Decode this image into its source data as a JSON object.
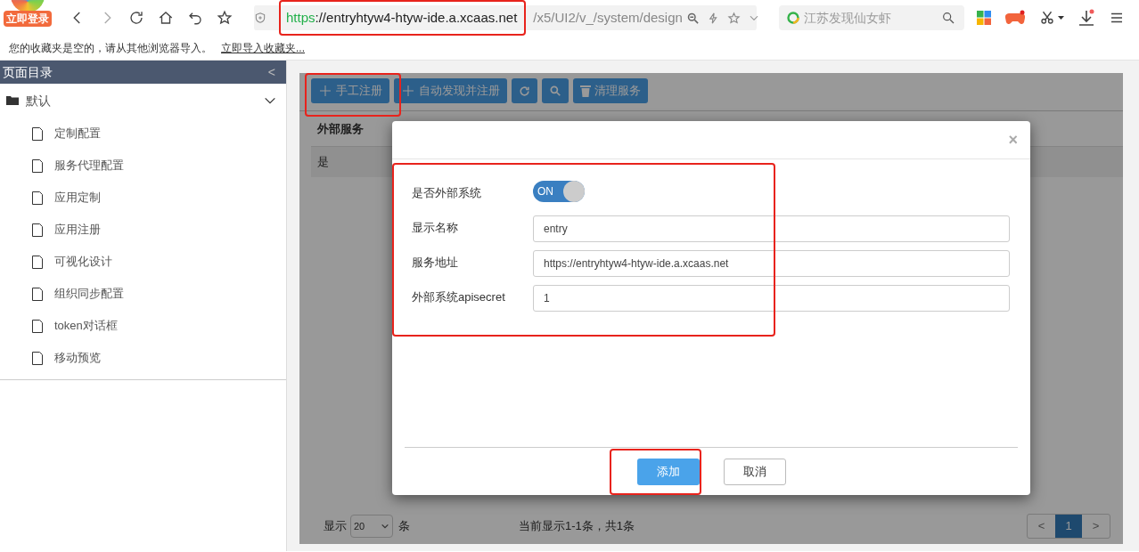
{
  "browser": {
    "login_badge": "立即登录",
    "url": {
      "scheme": "https",
      "host": "://entryhtyw4-htyw-ide.a.xcaas.net",
      "path": "/x5/UI2/v_/system/design"
    },
    "search": {
      "placeholder": "江苏发现仙女虾"
    }
  },
  "bookmarks_bar": {
    "message": "您的收藏夹是空的，请从其他浏览器导入。",
    "link": "立即导入收藏夹..."
  },
  "sidebar": {
    "title": "页面目录",
    "collapse": "<",
    "group": {
      "label": "默认",
      "expanded": true,
      "children": [
        {
          "label": "定制配置"
        },
        {
          "label": "服务代理配置"
        },
        {
          "label": "应用定制"
        },
        {
          "label": "应用注册"
        },
        {
          "label": "可视化设计"
        },
        {
          "label": "组织同步配置"
        },
        {
          "label": "token对话框"
        },
        {
          "label": "移动预览"
        }
      ]
    }
  },
  "toolbar": [
    {
      "kind": "add",
      "label": "手工注册"
    },
    {
      "kind": "add",
      "label": "自动发现并注册"
    },
    {
      "kind": "refresh"
    },
    {
      "kind": "search"
    },
    {
      "kind": "trash",
      "label": "清理服务"
    }
  ],
  "table": {
    "columns": [
      "外部服务"
    ],
    "rows": [
      [
        "是"
      ]
    ]
  },
  "pagination": {
    "show_label": "显示",
    "page_size": "20",
    "unit": "条",
    "summary": "当前显示1-1条，共1条",
    "prev": "<",
    "next": ">",
    "pages": [
      {
        "label": "1",
        "selected": true
      }
    ]
  },
  "modal": {
    "close": "×",
    "fields": [
      {
        "kind": "switch",
        "label": "是否外部系统",
        "on": true,
        "on_text": "ON"
      },
      {
        "kind": "text",
        "label": "显示名称",
        "value": "entry"
      },
      {
        "kind": "text",
        "label": "服务地址",
        "value": "https://entryhtyw4-htyw-ide.a.xcaas.net"
      },
      {
        "kind": "text",
        "label": "外部系统apisecret",
        "value": "1"
      }
    ],
    "buttons": [
      {
        "kind": "primary",
        "label": "添加"
      },
      {
        "kind": "default",
        "label": "取消"
      }
    ]
  }
}
